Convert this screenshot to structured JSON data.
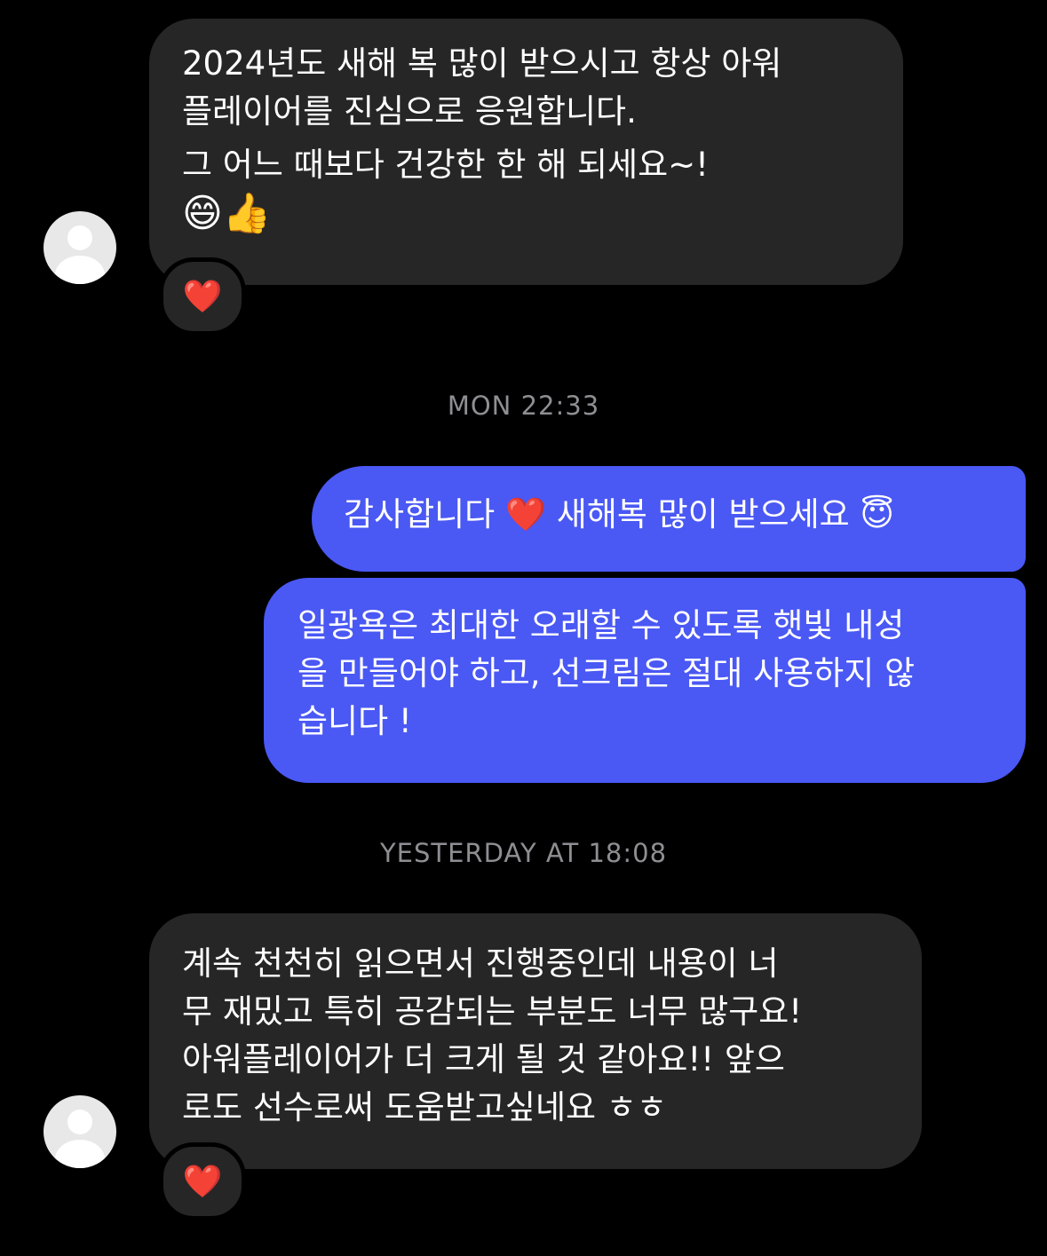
{
  "timestamps": {
    "first": "MON 22:33",
    "second": "YESTERDAY AT 18:08"
  },
  "messages": {
    "m1": {
      "lines": [
        "2024년도 새해 복 많이 받으시고 항상 아워",
        "플레이어를 진심으로 응원합니다.",
        "그 어느 때보다 건강한 한 해 되세요~!"
      ],
      "emoji": "😄👍",
      "reaction": "❤️"
    },
    "m2": {
      "text": "감사합니다 ❤️ 새해복 많이 받으세요 😇"
    },
    "m3": {
      "lines": [
        "일광욕은 최대한 오래할 수 있도록 햇빛 내성",
        "을 만들어야 하고, 선크림은 절대 사용하지 않",
        "습니다 !"
      ]
    },
    "m4": {
      "lines": [
        "계속 천천히 읽으면서 진행중인데 내용이 너",
        "무 재밌고 특히 공감되는 부분도 너무 많구요!",
        "아워플레이어가 더 크게 될 것 같아요!! 앞으",
        "로도 선수로써 도움받고싶네요 ㅎㅎ"
      ],
      "reaction": "❤️"
    }
  },
  "colors": {
    "background": "#000000",
    "incoming_bubble": "#262626",
    "outgoing_bubble": "#4a58f4",
    "timestamp_text": "#8e8e93",
    "reaction_heart": "#e0262b"
  },
  "icons": {
    "avatar": "default-user-avatar-icon",
    "reaction": "heart-icon"
  }
}
